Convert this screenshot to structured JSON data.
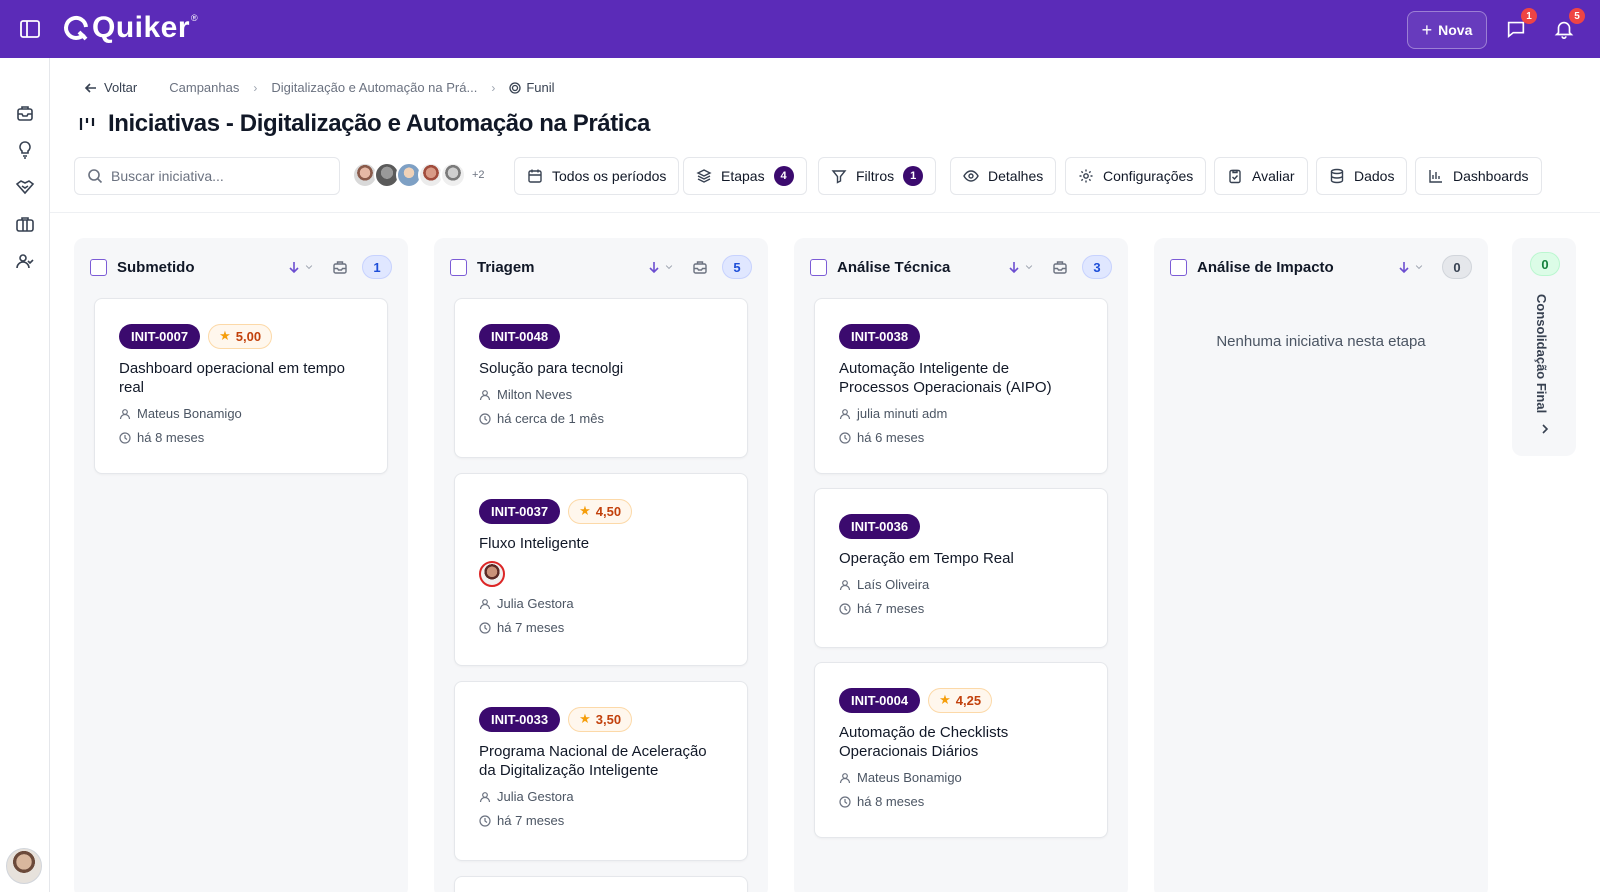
{
  "app": {
    "logo_text": "Quiker",
    "logo_reg": "®"
  },
  "topbar": {
    "new_label": "Nova",
    "messages_badge": "1",
    "notifications_badge": "5"
  },
  "breadcrumb": {
    "back": "Voltar",
    "items": [
      "Campanhas",
      "Digitalização e Automação na Prá..."
    ],
    "current": "Funil"
  },
  "page_title": "Iniciativas - Digitalização e Automação na Prática",
  "toolbar": {
    "search_placeholder": "Buscar iniciativa...",
    "avatars_more": "+2",
    "periods": "Todos os períodos",
    "stages": "Etapas",
    "stages_count": "4",
    "filters": "Filtros",
    "filters_count": "1",
    "details": "Detalhes",
    "settings": "Configurações",
    "evaluate": "Avaliar",
    "data": "Dados",
    "dashboards": "Dashboards"
  },
  "columns": [
    {
      "title": "Submetido",
      "count": "1",
      "cards": [
        {
          "id": "INIT-0007",
          "score": "5,00",
          "title": "Dashboard operacional em tempo real",
          "author": "Mateus Bonamigo",
          "time": "há 8 meses"
        }
      ]
    },
    {
      "title": "Triagem",
      "count": "5",
      "cards": [
        {
          "id": "INIT-0048",
          "title": "Solução para tecnolgi",
          "author": "Milton Neves",
          "time": "há cerca de 1 mês"
        },
        {
          "id": "INIT-0037",
          "score": "4,50",
          "title": "Fluxo Inteligente",
          "author": "Julia Gestora",
          "time": "há 7 meses"
        },
        {
          "id": "INIT-0033",
          "score": "3,50",
          "title": "Programa Nacional de Aceleração da Digitalização Inteligente",
          "author": "Julia Gestora",
          "time": "há 7 meses"
        }
      ]
    },
    {
      "title": "Análise Técnica",
      "count": "3",
      "cards": [
        {
          "id": "INIT-0038",
          "title": "Automação Inteligente de Processos Operacionais (AIPO)",
          "author": "julia minuti adm",
          "time": "há 6 meses"
        },
        {
          "id": "INIT-0036",
          "title": "Operação em Tempo Real",
          "author": "Laís Oliveira",
          "time": "há 7 meses"
        },
        {
          "id": "INIT-0004",
          "score": "4,25",
          "title": "Automação de Checklists Operacionais Diários",
          "author": "Mateus Bonamigo",
          "time": "há 8 meses"
        }
      ]
    },
    {
      "title": "Análise de Impacto",
      "count": "0",
      "empty_text": "Nenhuma iniciativa nesta etapa"
    }
  ],
  "collapsed_column": {
    "title": "Consolidação Final",
    "count": "0"
  },
  "colors": {
    "topbar": "#5b2bb8",
    "id_tag": "#3b0a6e",
    "accent": "#6d4fd1"
  }
}
